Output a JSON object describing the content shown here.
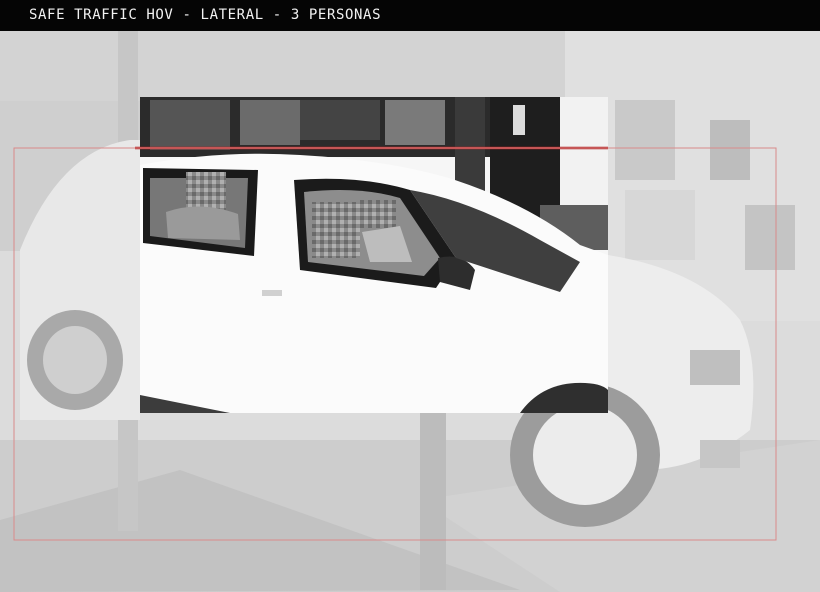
{
  "header": {
    "title": "SAFE TRAFFIC HOV - LATERAL - 3 PERSONAS"
  },
  "capture": {
    "camera_view": "lateral",
    "detected_persons": 3
  },
  "colors": {
    "title_bar_bg": "#050505",
    "title_text": "#f2f2f2",
    "detection_line": "#b42323",
    "detection_frame": "#d98a8a"
  }
}
